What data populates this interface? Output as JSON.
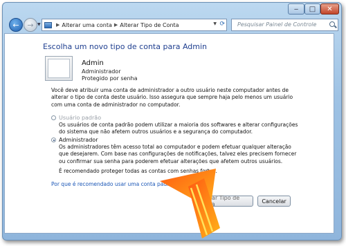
{
  "window": {
    "minimize_glyph": "‒",
    "maximize_glyph": "□",
    "close_glyph": "✕"
  },
  "nav": {
    "back_glyph": "←",
    "forward_glyph": "→",
    "breadcrumb": [
      "Alterar uma conta",
      "Alterar Tipo de Conta"
    ],
    "search_placeholder": "Pesquisar Painel de Controle"
  },
  "main": {
    "heading": "Escolha um novo tipo de conta para Admin",
    "account": {
      "name": "Admin",
      "type": "Administrador",
      "status": "Protegido por senha"
    },
    "intro": "Você deve atribuir uma conta de administrador a outro usuário neste computador antes de alterar o tipo de conta deste usuário. Isso assegura que sempre haja pelo menos um usuário com uma conta de administrador no computador.",
    "options": [
      {
        "label": "Usuário padrão",
        "description": "Os usuários de conta padrão podem utilizar a maioria dos softwares e alterar configurações do sistema que não afetem outros usuários e a segurança do computador.",
        "selected": false,
        "disabled": true
      },
      {
        "label": "Administrador",
        "description": "Os administradores têm acesso total ao computador e podem efetuar qualquer alteração que desejarem. Com base nas configurações de notificações, talvez eles precisem fornecer ou confirmar sua senha para poderem efetuar alterações que afetem outros usuários.",
        "selected": true,
        "disabled": false
      }
    ],
    "recommendation": "É recomendado proteger todas as contas com senhas fortes.",
    "help_link": "Por que é recomendado usar uma conta padrão?"
  },
  "buttons": {
    "change_type": "Alterar Tipo de Conta",
    "cancel": "Cancelar"
  },
  "colors": {
    "heading": "#1e3e8f",
    "link": "#1a56b6",
    "arrow_orange": "#f07a10",
    "arrow_yellow": "#ffd21a"
  }
}
